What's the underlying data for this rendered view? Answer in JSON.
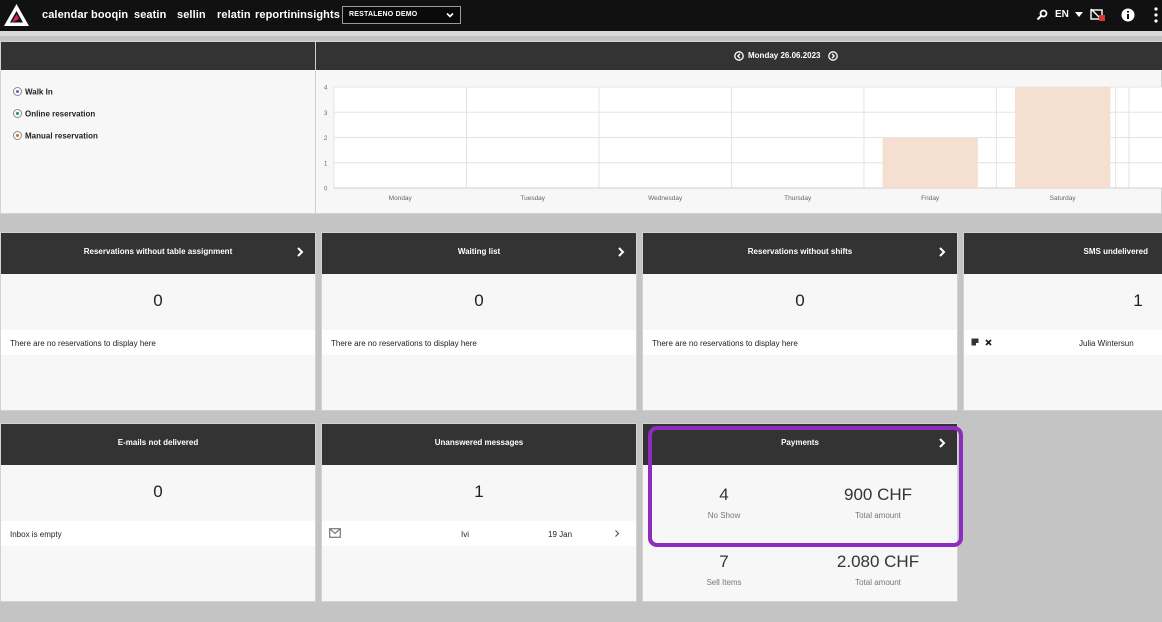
{
  "nav": {
    "links": [
      "calendar",
      "booqin",
      "seatin",
      "sellin",
      "relatin",
      "reportin",
      "insights"
    ],
    "venue": "RESTALENO DEMO",
    "language": "EN"
  },
  "chart": {
    "date": "Monday 26.06.2023",
    "legend": [
      "Walk In",
      "Online reservation",
      "Manual reservation"
    ]
  },
  "chart_data": {
    "type": "bar",
    "categories": [
      "Monday",
      "Tuesday",
      "Wednesday",
      "Thursday",
      "Friday",
      "Saturday"
    ],
    "series": [
      {
        "name": "Walk In",
        "values": [
          0,
          0,
          0,
          0,
          0,
          0
        ],
        "color": "#6a5acd"
      },
      {
        "name": "Online reservation",
        "values": [
          0,
          0,
          0,
          0,
          0,
          0
        ],
        "color": "#2e8b57"
      },
      {
        "name": "Manual reservation",
        "values": [
          0,
          0,
          0,
          0,
          2,
          4
        ],
        "color": "#f5dfd0"
      }
    ],
    "ylim": [
      0,
      4
    ],
    "yticks": [
      "0",
      "1",
      "2",
      "3",
      "4"
    ],
    "grid": true
  },
  "widgets": {
    "no_table": {
      "title": "Reservations without table assignment",
      "count": "0",
      "empty": "There are no reservations to display here"
    },
    "waiting": {
      "title": "Waiting list",
      "count": "0",
      "empty": "There are no reservations to display here"
    },
    "no_shifts": {
      "title": "Reservations without shifts",
      "count": "0",
      "empty": "There are no reservations to display here"
    },
    "sms": {
      "title": "SMS undelivered",
      "count": "1",
      "name": "Julia Wintersun"
    },
    "emails": {
      "title": "E-mails not delivered",
      "count": "0",
      "empty": "Inbox is empty"
    },
    "messages": {
      "title": "Unanswered messages",
      "count": "1",
      "sender": "Ivi",
      "date": "19 Jan"
    },
    "payments": {
      "title": "Payments",
      "no_show_count": "4",
      "no_show_label": "No Show",
      "no_show_amount": "900 CHF",
      "no_show_amount_label": "Total amount",
      "sell_count": "7",
      "sell_label": "Sell Items",
      "sell_amount": "2.080 CHF",
      "sell_amount_label": "Total amount"
    }
  },
  "colors": {
    "accent_highlight": "#8c2dbd",
    "header": "#333333",
    "bar": "#f5dfd0"
  }
}
